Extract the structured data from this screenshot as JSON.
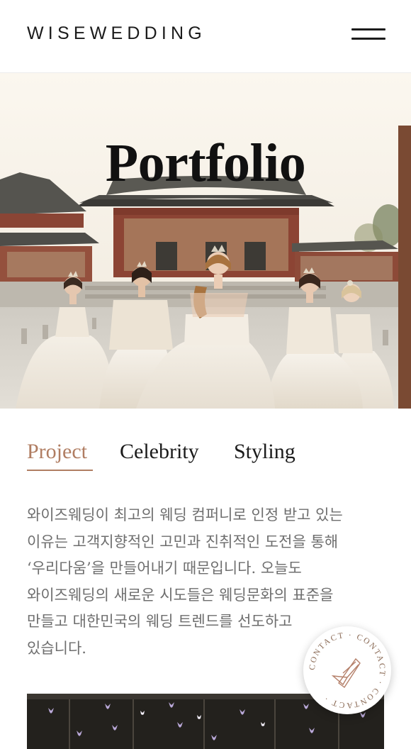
{
  "header": {
    "logo": "WISEWEDDING",
    "menu_icon": "hamburger-menu-icon"
  },
  "hero": {
    "title": "Portfolio"
  },
  "tabs": [
    {
      "label": "Project",
      "active": true
    },
    {
      "label": "Celebrity",
      "active": false
    },
    {
      "label": "Styling",
      "active": false
    }
  ],
  "description": {
    "lines": [
      "와이즈웨딩이 최고의 웨딩 컴퍼니로 인정 받고 있는",
      "이유는 고객지향적인 고민과 진취적인 도전을 통해",
      "‘우리다움’을 만들어내기 때문입니다. 오늘도",
      "와이즈웨딩의 새로운 시도들은 웨딩문화의 표준을",
      "만들고 대한민국의 웨딩 트렌드를 선도하고",
      "있습니다."
    ]
  },
  "contact": {
    "ring_text": "CONTACT · CONTACT · CONTACT · ",
    "icon": "contact-letter-icon"
  },
  "colors": {
    "accent": "#b07d62",
    "text_dark": "#1b1b1b",
    "text_muted": "#6e6e6e"
  }
}
